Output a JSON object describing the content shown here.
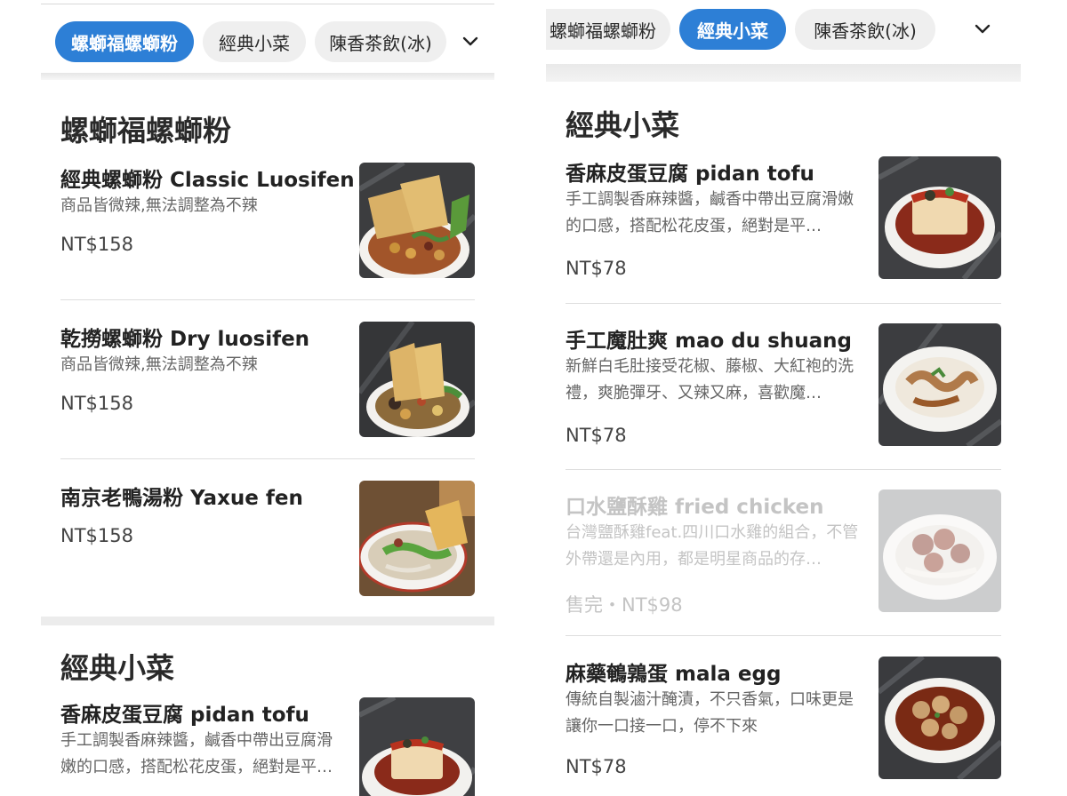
{
  "left": {
    "tabs": [
      {
        "label": "螺螄福螺螄粉",
        "active": true
      },
      {
        "label": "經典小菜",
        "active": false
      },
      {
        "label": "陳香茶飲(冰)",
        "active": false
      }
    ],
    "sections": [
      {
        "title": "螺螄福螺螄粉",
        "items": [
          {
            "name": "經典螺螄粉 Classic Luosifen",
            "desc": "商品皆微辣,無法調整為不辣",
            "price": "NT$158"
          },
          {
            "name": "乾撈螺螄粉 Dry luosifen",
            "desc": "商品皆微辣,無法調整為不辣",
            "price": "NT$158"
          },
          {
            "name": "南京老鴨湯粉 Yaxue fen",
            "desc": "",
            "price": "NT$158"
          }
        ]
      },
      {
        "title": "經典小菜",
        "items": [
          {
            "name": "香麻皮蛋豆腐 pidan tofu",
            "desc": "手工調製香麻辣醬，鹹香中帶出豆腐滑嫩的口感，搭配松花皮蛋，絕對是平…",
            "price": ""
          }
        ]
      }
    ]
  },
  "right": {
    "tabs": [
      {
        "label": "螺螄福螺螄粉",
        "active": false
      },
      {
        "label": "經典小菜",
        "active": true
      },
      {
        "label": "陳香茶飲(冰)",
        "active": false
      }
    ],
    "section": {
      "title": "經典小菜",
      "items": [
        {
          "name": "香麻皮蛋豆腐 pidan tofu",
          "desc": "手工調製香麻辣醬，鹹香中帶出豆腐滑嫩的口感，搭配松花皮蛋，絕對是平…",
          "price": "NT$78",
          "soldout": false
        },
        {
          "name": "手工魔肚爽 mao du shuang",
          "desc": "新鮮白毛肚接受花椒、藤椒、大紅袍的洗禮，爽脆彈牙、又辣又麻，喜歡魔…",
          "price": "NT$78",
          "soldout": false
        },
        {
          "name": "口水鹽酥雞 fried chicken",
          "desc": "台灣鹽酥雞feat.四川口水雞的組合，不管外帶還是內用，都是明星商品的存…",
          "price": "售完・NT$98",
          "soldout": true
        },
        {
          "name": "麻藥鵪鶉蛋 mala egg",
          "desc": "傳統自製滷汁醃漬，不只香氣，口味更是讓你一口接一口，停不下來",
          "price": "NT$78",
          "soldout": false
        }
      ]
    }
  },
  "colors": {
    "accent": "#2d7fd6",
    "tab_bg": "#efefef",
    "band": "#ececec",
    "soldout_text": "#c4c4c4"
  },
  "icons": {
    "dropdown": "chevron-down-icon"
  }
}
